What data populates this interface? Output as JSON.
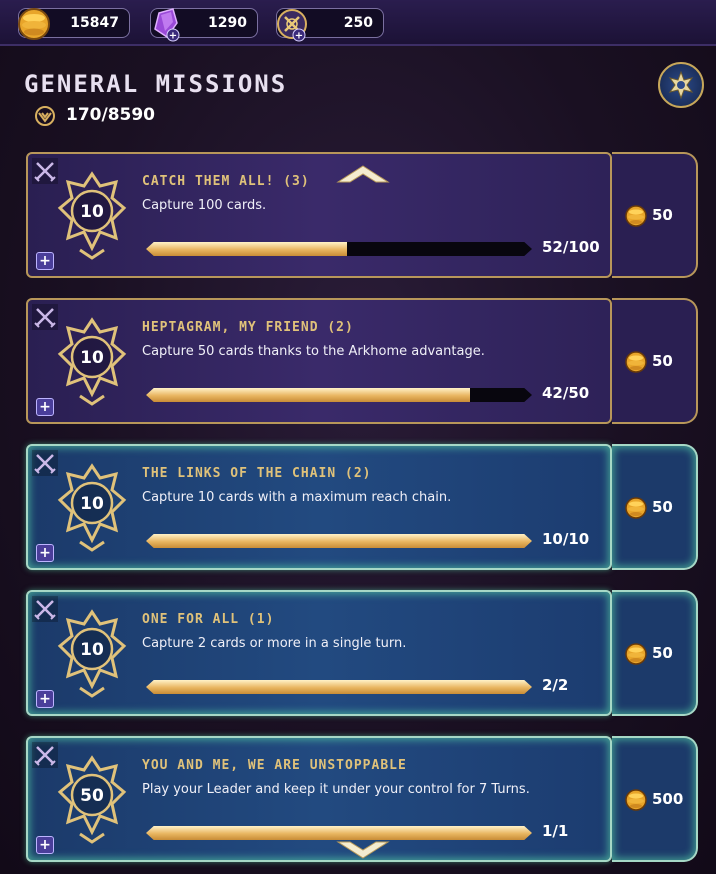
{
  "currencies": [
    {
      "icon": "gold-coin-icon",
      "value": "15847"
    },
    {
      "icon": "crystal-icon",
      "value": "1290"
    },
    {
      "icon": "card-pack-icon",
      "value": "250"
    }
  ],
  "header": {
    "title": "GENERAL MISSIONS",
    "progress": "170/8590"
  },
  "missions": [
    {
      "level": "10",
      "title": "CATCH THEM ALL! (3)",
      "description": "Capture 100 cards.",
      "progress_text": "52/100",
      "progress": 0.52,
      "reward": "50",
      "style": "purple"
    },
    {
      "level": "10",
      "title": "HEPTAGRAM, MY FRIEND (2)",
      "description": "Capture 50 cards thanks to the Arkhome advantage.",
      "progress_text": "42/50",
      "progress": 0.84,
      "reward": "50",
      "style": "purple"
    },
    {
      "level": "10",
      "title": "THE LINKS OF THE CHAIN (2)",
      "description": "Capture 10 cards with a maximum reach chain.",
      "progress_text": "10/10",
      "progress": 1.0,
      "reward": "50",
      "style": "teal"
    },
    {
      "level": "10",
      "title": "ONE FOR ALL (1)",
      "description": "Capture 2 cards or more in a single turn.",
      "progress_text": "2/2",
      "progress": 1.0,
      "reward": "50",
      "style": "teal"
    },
    {
      "level": "50",
      "title": "YOU AND ME, WE ARE UNSTOPPABLE",
      "description": "Play your Leader and keep it under your control for 7 Turns.",
      "progress_text": "1/1",
      "progress": 1.0,
      "reward": "500",
      "style": "teal"
    }
  ],
  "plus_label": "+",
  "colors": {
    "gold": "#e0c27a",
    "teal_glow": "#5adcaa",
    "purple_card": "#2a1f52",
    "blue_card": "#1c3a6a"
  }
}
